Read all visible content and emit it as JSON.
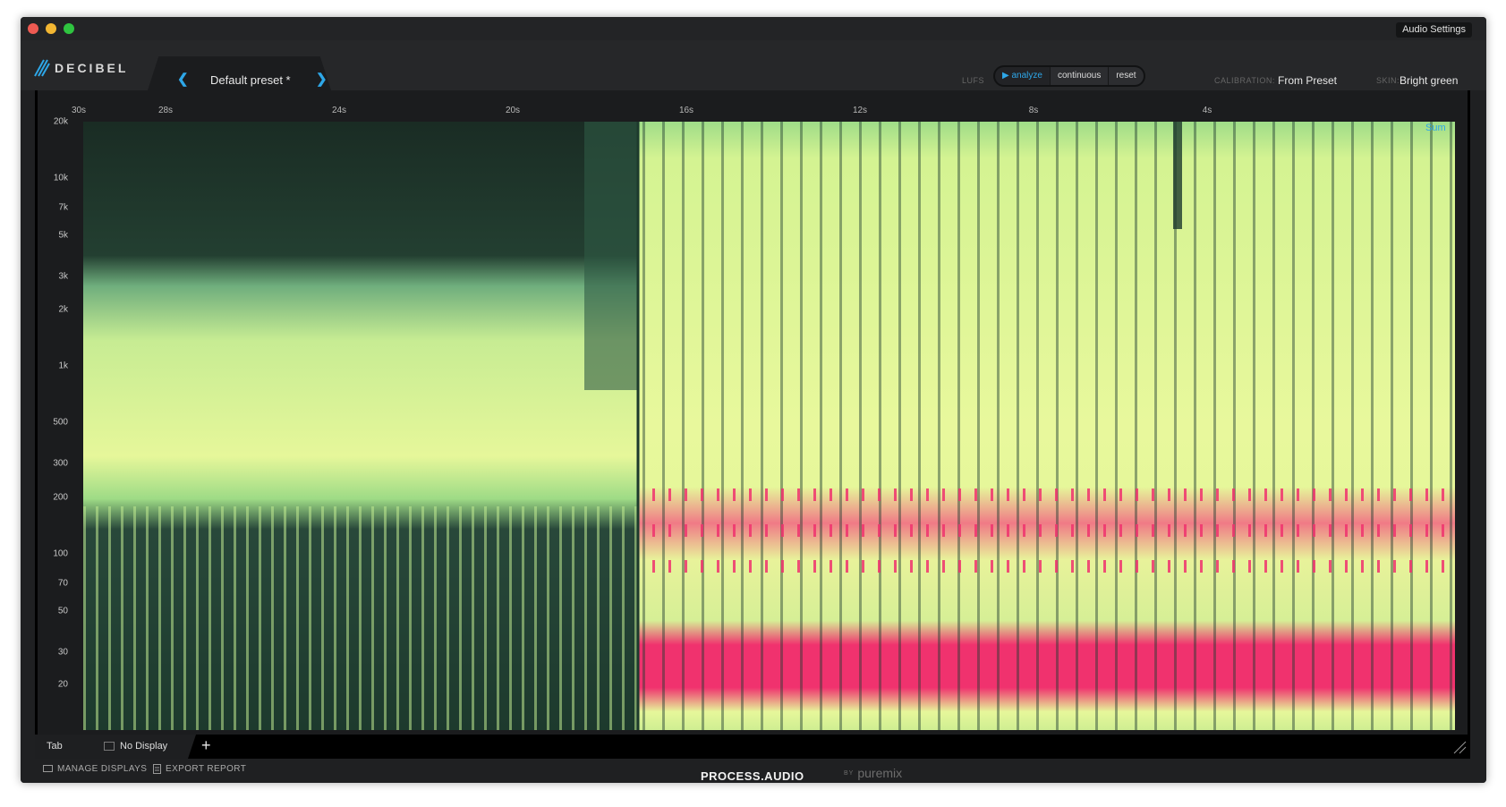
{
  "window": {
    "audio_settings_label": "Audio Settings"
  },
  "toolbar": {
    "logo_text": "DECIBEL",
    "preset_name": "Default preset *",
    "lufs_label": "LUFS",
    "lufs_buttons": {
      "analyze": "analyze",
      "continuous": "continuous",
      "reset": "reset"
    },
    "calibration_label": "CALIBRATION:",
    "calibration_value": "From Preset",
    "skin_label": "SKIN:",
    "skin_value": "Bright green"
  },
  "spectrogram": {
    "time_labels": [
      "30s",
      "28s",
      "24s",
      "20s",
      "16s",
      "12s",
      "8s",
      "4s"
    ],
    "freq_labels": [
      "20k",
      "10k",
      "7k",
      "5k",
      "3k",
      "2k",
      "1k",
      "500",
      "300",
      "200",
      "100",
      "70",
      "50",
      "30",
      "20"
    ],
    "channel_label": "Sum",
    "colors": {
      "dark": "#1e3a2e",
      "mid": "#6fcf8a",
      "high": "#e6f79a",
      "peak": "#f0326e"
    }
  },
  "tabbar": {
    "tab_label": "Tab",
    "display_label": "No Display",
    "add_label": "+"
  },
  "footer": {
    "manage_displays": "MANAGE DISPLAYS",
    "export_report": "EXPORT REPORT",
    "brand": "PROCESS.AUDIO",
    "by": "BY",
    "partner": "puremix"
  }
}
